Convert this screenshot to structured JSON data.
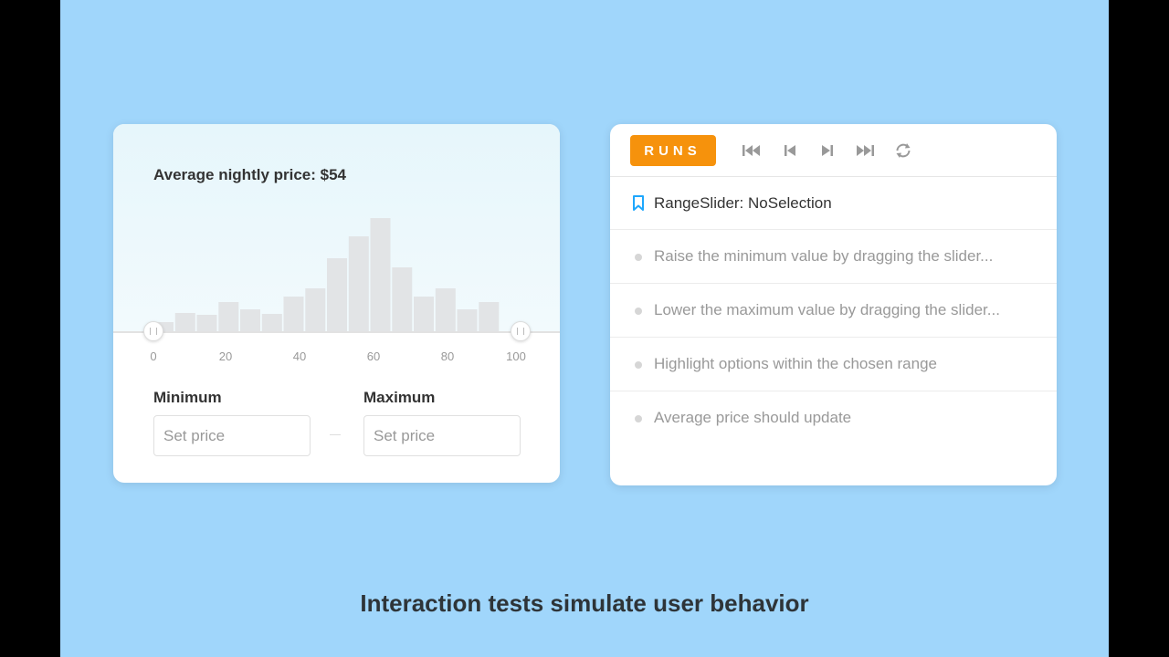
{
  "filter_card": {
    "average_label": "Average nightly price: $54",
    "axis_ticks": [
      "0",
      "20",
      "40",
      "60",
      "80",
      "100"
    ],
    "minimum": {
      "label": "Minimum",
      "value": "",
      "placeholder": "Set price"
    },
    "maximum": {
      "label": "Maximum",
      "value": "",
      "placeholder": "Set price"
    }
  },
  "chart_data": {
    "type": "bar",
    "x": [
      0,
      6.25,
      12.5,
      18.75,
      25,
      31.25,
      37.5,
      43.75,
      50,
      56.25,
      62.5,
      68.75,
      75,
      81.25,
      87.5,
      93.75
    ],
    "values": [
      10,
      20,
      18,
      32,
      24,
      19,
      38,
      47,
      80,
      104,
      124,
      70,
      38,
      47,
      24,
      32
    ],
    "xlim": [
      0,
      100
    ],
    "range_selection": [
      0,
      100
    ],
    "bar_color": "#e2e4e6"
  },
  "runner": {
    "runs_label": "RUNS",
    "controls": [
      "skip-to-start-icon",
      "step-back-icon",
      "step-forward-icon",
      "skip-to-end-icon",
      "rerun-icon"
    ],
    "story_title": "RangeSlider: NoSelection",
    "steps": [
      "Raise the minimum value by dragging the slider...",
      "Lower the maximum value by dragging the slider...",
      "Highlight options within the chosen range",
      "Average price should update"
    ],
    "accent_color": "#f6920c",
    "bookmark_color": "#1ea7fd"
  },
  "caption": "Interaction tests simulate user behavior"
}
